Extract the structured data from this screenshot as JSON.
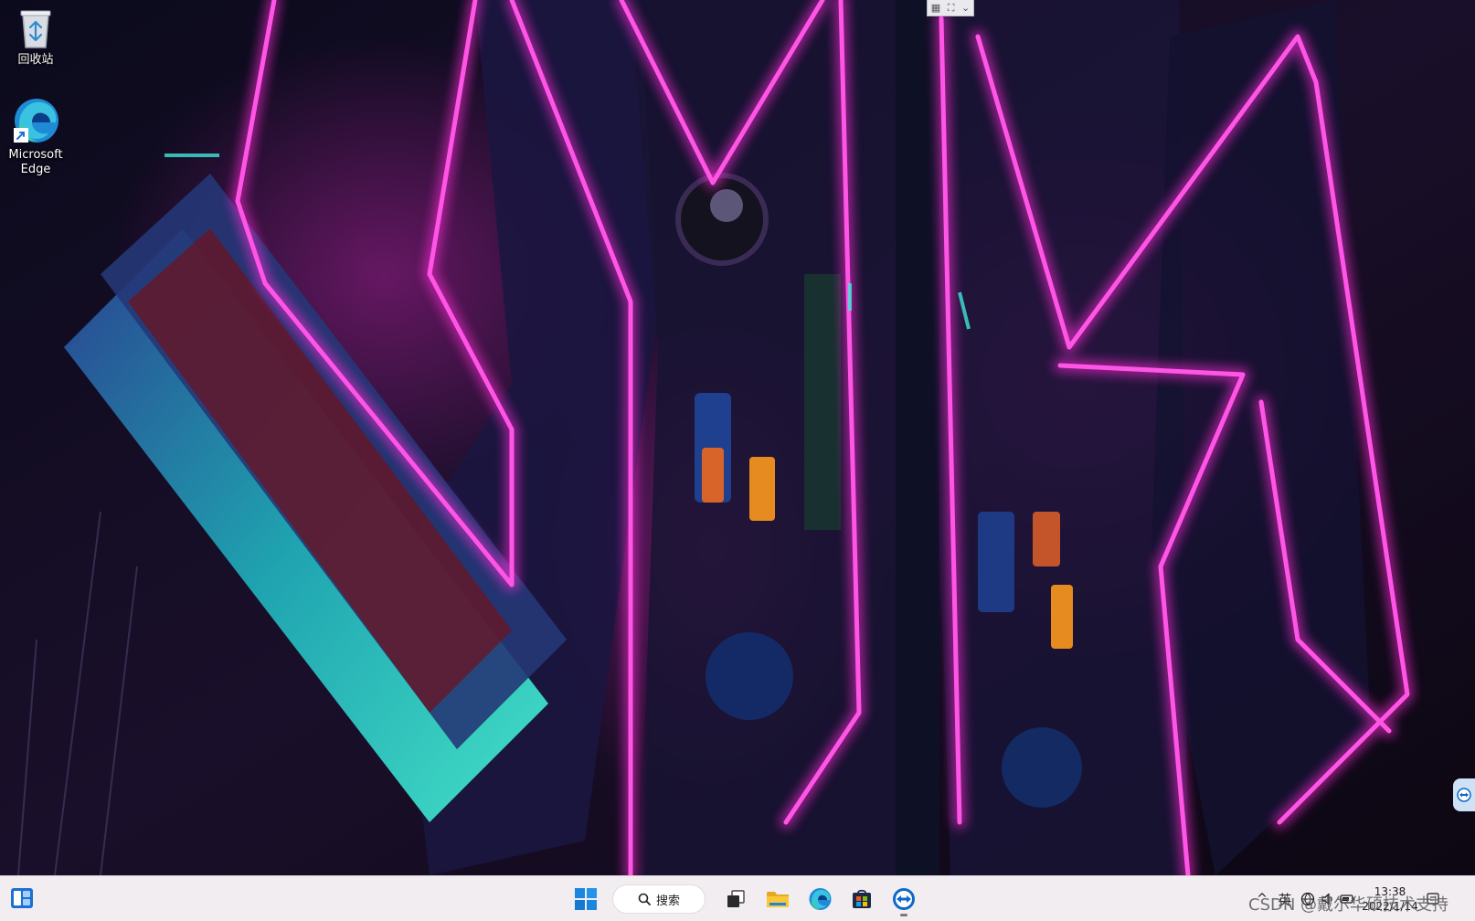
{
  "desktop": {
    "icons": [
      {
        "label": "回收站",
        "icon": "recycle-bin-icon"
      },
      {
        "label_line1": "Microsoft",
        "label_line2": "Edge",
        "icon": "edge-icon",
        "has_shortcut_arrow": true
      }
    ]
  },
  "top_widget": {
    "icons": [
      "grid-icon",
      "fullscreen-icon",
      "chevron-down-icon"
    ]
  },
  "taskbar": {
    "search": {
      "label": "搜索"
    },
    "pinned": [
      "start-icon",
      "task-view-icon",
      "file-explorer-icon",
      "edge-icon",
      "store-icon",
      "teamviewer-icon"
    ],
    "tray": {
      "overflow_icon": "chevron-up-icon",
      "ime": "英",
      "time": "13:38",
      "date": "2022/1/14"
    }
  },
  "watermark": "CSDN @戴尔华硕技术支持",
  "colors": {
    "neon_pink": "#ff2bd6",
    "neon_cyan": "#3fe6d8",
    "taskbar_bg": "#f1edf1",
    "accent_blue": "#0078d4"
  }
}
